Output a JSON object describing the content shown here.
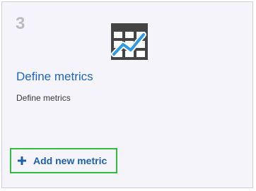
{
  "card": {
    "step_number": "3",
    "icon": "table-chart-icon",
    "title": "Define metrics",
    "subtitle": "Define metrics",
    "add_button": {
      "label": "Add new metric",
      "icon": "plus-icon"
    }
  },
  "colors": {
    "card_background": "#f4f4fa",
    "card_border": "#cfd0d8",
    "step_number": "#b9bcc6",
    "title_link": "#1f66c1",
    "button_text": "#1f5fae",
    "button_highlight_border": "#2fbd3a",
    "icon_grid": "#444444",
    "icon_trend_line": "#2e9be8"
  }
}
